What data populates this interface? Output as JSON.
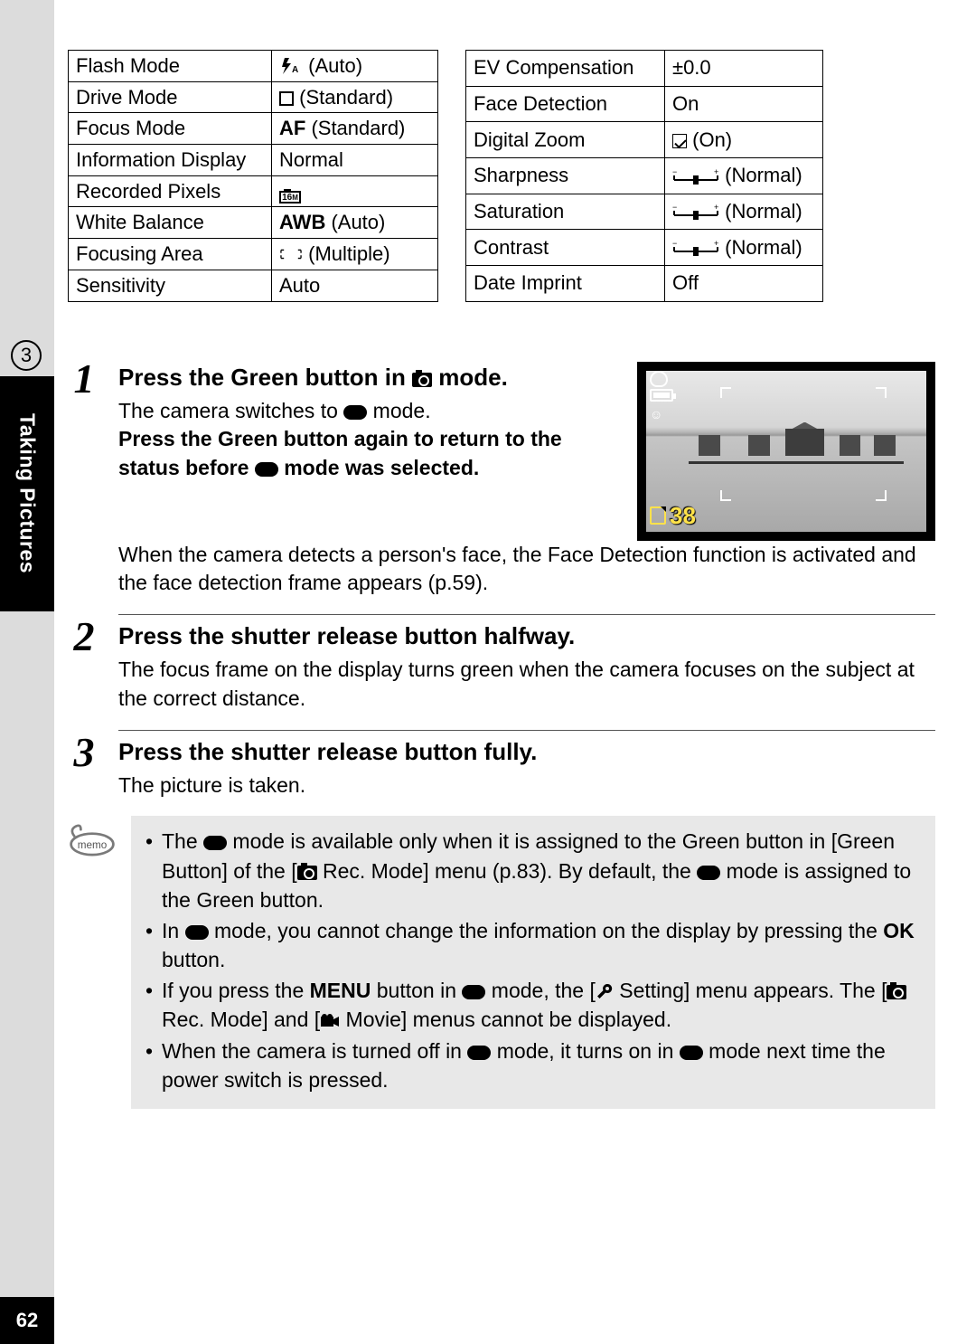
{
  "chapter_number": "3",
  "section_label": "Taking Pictures",
  "page_number": "62",
  "tables": {
    "left": [
      {
        "label": "Flash Mode",
        "icon": "flash-auto",
        "value": "(Auto)"
      },
      {
        "label": "Drive Mode",
        "icon": "square",
        "value": "(Standard)"
      },
      {
        "label": "Focus Mode",
        "prefix_bold": "AF",
        "value": " (Standard)"
      },
      {
        "label": "Information Display",
        "value": "Normal"
      },
      {
        "label": "Recorded Pixels",
        "icon": "16m",
        "value": ""
      },
      {
        "label": "White Balance",
        "prefix_bold": "AWB",
        "value": " (Auto)"
      },
      {
        "label": "Focusing Area",
        "icon": "multi-af",
        "value": "(Multiple)"
      },
      {
        "label": "Sensitivity",
        "value": "Auto"
      }
    ],
    "right": [
      {
        "label": "EV Compensation",
        "value": "±0.0"
      },
      {
        "label": "Face Detection",
        "value": "On"
      },
      {
        "label": "Digital Zoom",
        "icon": "checkbox",
        "value": "(On)"
      },
      {
        "label": "Sharpness",
        "icon": "slider",
        "value": "(Normal)"
      },
      {
        "label": "Saturation",
        "icon": "slider",
        "value": "(Normal)"
      },
      {
        "label": "Contrast",
        "icon": "slider",
        "value": "(Normal)"
      },
      {
        "label": "Date Imprint",
        "value": "Off"
      }
    ]
  },
  "steps": {
    "s1": {
      "num": "1",
      "title_a": "Press the Green button in ",
      "title_b": " mode.",
      "p1_a": "The camera switches to ",
      "p1_b": " mode.",
      "p2_a": "Press the Green button again to return to the status before ",
      "p2_b": " mode was selected.",
      "p3": "When the camera detects a person's face, the Face Detection function is activated and the face detection frame appears (p.59)."
    },
    "s2": {
      "num": "2",
      "title": "Press the shutter release button halfway.",
      "p": "The focus frame on the display turns green when the camera focuses on the subject at the correct distance."
    },
    "s3": {
      "num": "3",
      "title": "Press the shutter release button fully.",
      "p": "The picture is taken."
    }
  },
  "lcd": {
    "count": "38"
  },
  "memo": {
    "b1a": "The ",
    "b1b": " mode is available only when it is assigned to the Green button in [Green Button] of the [",
    "b1c": " Rec. Mode] menu (p.83). By default, the ",
    "b1d": " mode is assigned to the Green button.",
    "b2a": "In ",
    "b2b": " mode, you cannot change the information on the display by pressing the ",
    "b2_ok": "OK",
    "b2c": " button.",
    "b3a": "If you press the ",
    "b3_menu": "MENU",
    "b3b": " button in ",
    "b3c": " mode, the [",
    "b3d": " Setting] menu appears. The [",
    "b3e": " Rec. Mode] and [",
    "b3f": " Movie] menus cannot be displayed.",
    "b4a": "When the camera is turned off in ",
    "b4b": " mode, it turns on in ",
    "b4c": " mode next time the power switch is pressed."
  }
}
